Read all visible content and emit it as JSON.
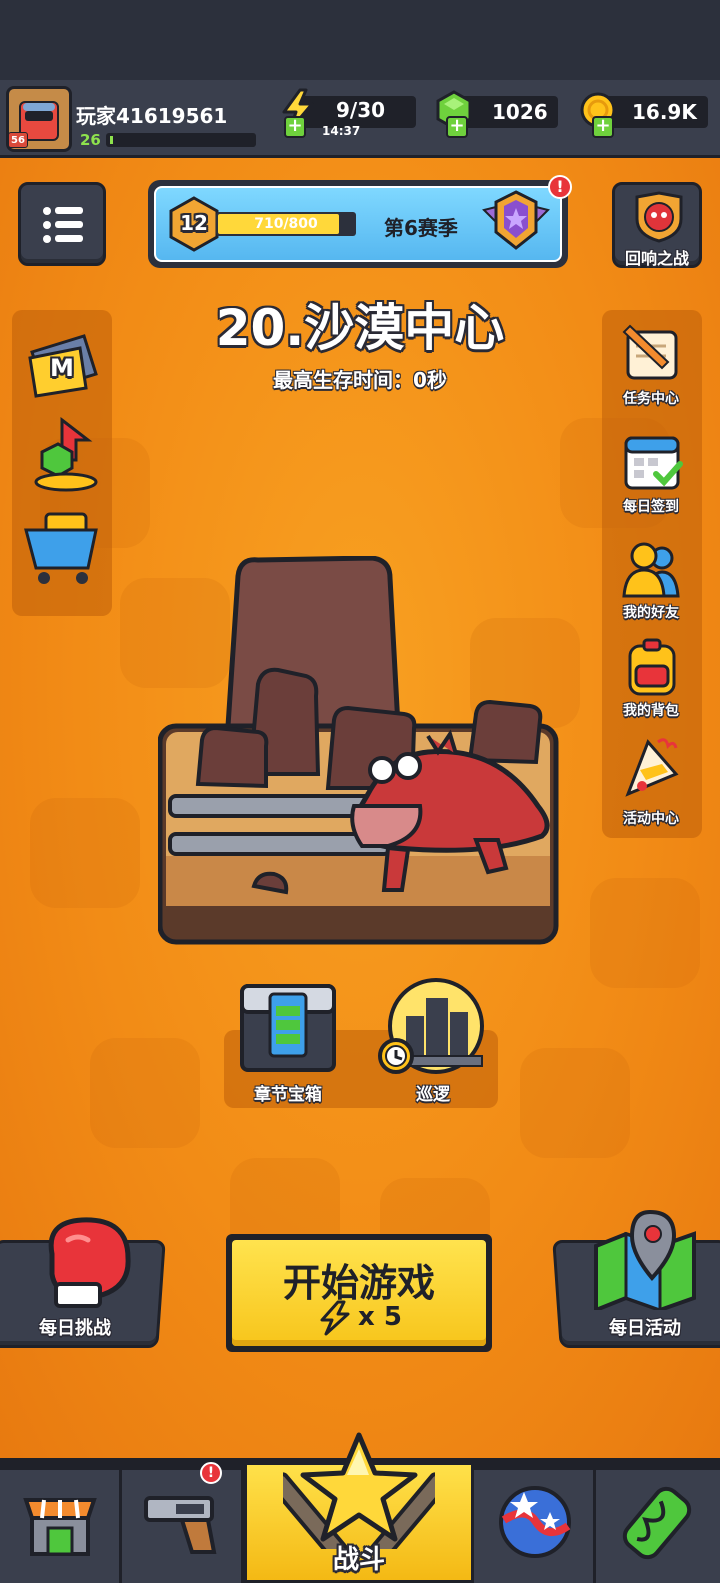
{
  "player": {
    "name": "玩家41619561",
    "level": "26",
    "avatar_badge": "56",
    "xp_progress": 0.02
  },
  "resources": {
    "energy": "9/30",
    "energy_timer": "14:37",
    "gems": "1026",
    "gold": "16.9K"
  },
  "season": {
    "rank": "12",
    "progress_text": "710/800",
    "progress": 0.8875,
    "label": "第6赛季",
    "alert": "!"
  },
  "top_right_button": {
    "label": "回响之战"
  },
  "stage": {
    "title": "20.沙漠中心",
    "best_time": "最高生存时间：0秒"
  },
  "left_sidebar": {
    "items": [
      {
        "icon": "m-card-icon",
        "letter": "M"
      },
      {
        "icon": "gem-upgrade-icon"
      },
      {
        "icon": "shop-cart-icon"
      }
    ]
  },
  "right_sidebar": {
    "items": [
      {
        "icon": "scroll-quill-icon",
        "label": "任务中心"
      },
      {
        "icon": "calendar-check-icon",
        "label": "每日签到"
      },
      {
        "icon": "friends-icon",
        "label": "我的好友"
      },
      {
        "icon": "backpack-icon",
        "label": "我的背包"
      },
      {
        "icon": "party-popper-icon",
        "label": "活动中心"
      }
    ]
  },
  "chapter_chest": {
    "label": "章节宝箱"
  },
  "patrol": {
    "label": "巡逻"
  },
  "daily_challenge": {
    "label": "每日挑战"
  },
  "start_game": {
    "label": "开始游戏",
    "cost": "x 5"
  },
  "daily_event": {
    "label": "每日活动"
  },
  "bottom_nav": {
    "items": [
      {
        "icon": "shop-icon"
      },
      {
        "icon": "weapon-icon",
        "alert": "!"
      },
      {
        "icon": "star-swords-icon",
        "label": "战斗"
      },
      {
        "icon": "talent-orb-icon"
      },
      {
        "icon": "dna-capsule-icon"
      }
    ]
  },
  "colors": {
    "background": "#f08a16",
    "panel_dark": "#3a3f4d",
    "accent_yellow": "#ffd83a",
    "energy": "#ffd83a",
    "gem": "#6fd13d",
    "alert": "#e8343a"
  }
}
